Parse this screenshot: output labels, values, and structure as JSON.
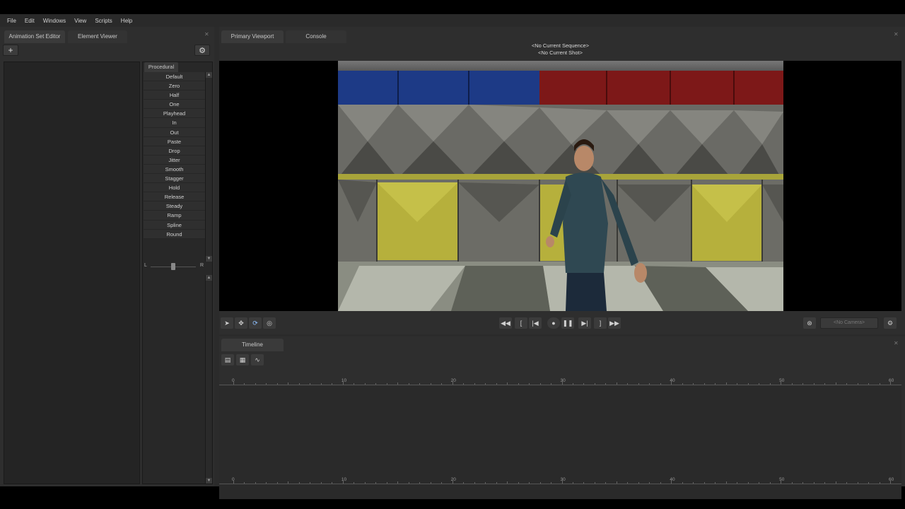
{
  "menu": [
    "File",
    "Edit",
    "Windows",
    "View",
    "Scripts",
    "Help"
  ],
  "left_panel": {
    "tabs": [
      "Animation Set Editor",
      "Element Viewer"
    ],
    "add_button": "+",
    "settings_icon": "gear-icon",
    "procedural": {
      "header": "Procedural",
      "items": [
        "Default",
        "Zero",
        "Half",
        "One",
        "Playhead",
        "In",
        "Out",
        "Paste",
        "Drop",
        "Jitter",
        "Smooth",
        "Stagger",
        "Hold",
        "Release",
        "Steady",
        "Ramp",
        "Spline",
        "Round"
      ],
      "slider_left": "L",
      "slider_right": "R",
      "slider_value": 0.5
    }
  },
  "viewport_panel": {
    "tabs": [
      "Primary Viewport",
      "Console"
    ],
    "sequence": "<No Current Sequence>",
    "shot": "<No Current Shot>",
    "camera": "<No Camera>",
    "tools": [
      "select-arrow-icon",
      "move-icon",
      "rotate-icon",
      "orbit-icon"
    ],
    "playback": [
      "rewind-icon",
      "prev-key-icon",
      "start-icon",
      "record-icon",
      "pause-icon",
      "end-icon",
      "next-key-icon",
      "fast-forward-icon"
    ]
  },
  "timeline_panel": {
    "tab": "Timeline",
    "ruler_labels": [
      "0",
      "10",
      "20",
      "30",
      "40",
      "50",
      "60"
    ]
  },
  "colors": {
    "bg": "#2b2b2b",
    "panel": "#2e2e2e",
    "accent_blue": "#1a3d8f",
    "accent_red": "#7a1616",
    "yellow_tile": "#c8c23a"
  }
}
